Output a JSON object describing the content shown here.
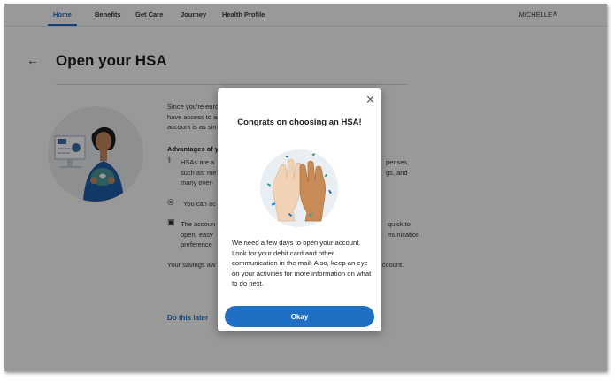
{
  "nav": {
    "items": [
      {
        "label": "Home",
        "active": true
      },
      {
        "label": "Benefits",
        "active": false
      },
      {
        "label": "Get Care",
        "active": false
      },
      {
        "label": "Journey",
        "active": false
      },
      {
        "label": "Health Profile",
        "active": false
      }
    ],
    "user_name": "MICHELLE",
    "accent_color": "#1f6fc5"
  },
  "page": {
    "title": "Open your HSA",
    "intro_lines": [
      "Since you're enro",
      "have access to a",
      "account is as sin"
    ],
    "advantages_heading": "Advantages of y",
    "advantages": [
      {
        "icon": "stethoscope-icon",
        "lines": [
          "HSAs are a",
          "such as: me",
          "many over-"
        ],
        "right_lines": [
          "penses,",
          "gs, and",
          ""
        ]
      },
      {
        "icon": "piggy-bank-icon",
        "lines": [
          "You can ac"
        ],
        "right_lines": [
          ""
        ]
      },
      {
        "icon": "briefcase-icon",
        "lines": [
          "The accoun",
          "open, easy",
          "preference"
        ],
        "right_lines": [
          "quick to",
          "munication",
          ""
        ]
      }
    ],
    "savings_line_left": "Your savings aw",
    "savings_line_right": "ccount.",
    "do_later_label": "Do this later"
  },
  "modal": {
    "title": "Congrats on choosing an HSA!",
    "body": "We need a few days to open your account. Look for your debit card and other communication in the mail. Also, keep an eye on your activities for more information on what to do next.",
    "button_label": "Okay",
    "close_icon": "close-icon"
  }
}
